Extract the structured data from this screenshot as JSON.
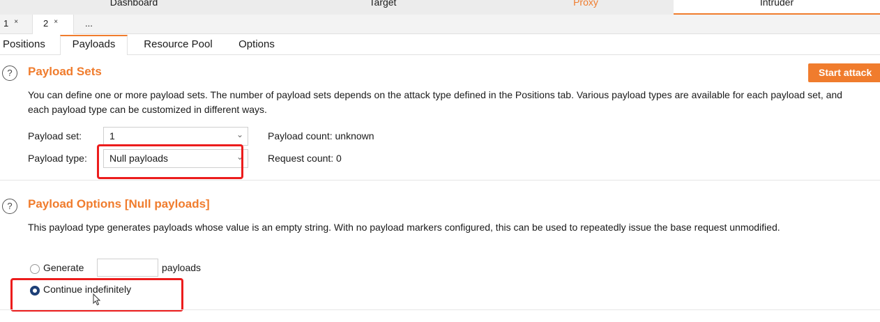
{
  "top_tabs": {
    "dashboard": "Dashboard",
    "target": "Target",
    "proxy": "Proxy",
    "intruder": "Intruder"
  },
  "attack_tabs": {
    "tab1": "1",
    "tab2": "2",
    "more": "...",
    "close_glyph": "×"
  },
  "sub_tabs": {
    "positions": "Positions",
    "payloads": "Payloads",
    "resource_pool": "Resource Pool",
    "options": "Options"
  },
  "help_glyph": "?",
  "payload_sets": {
    "title": "Payload Sets",
    "start_attack": "Start attack",
    "description": "You can define one or more payload sets. The number of payload sets depends on the attack type defined in the Positions tab. Various payload types are available for each payload set, and each payload type can be customized in different ways.",
    "payload_set_label": "Payload set:",
    "payload_set_value": "1",
    "payload_type_label": "Payload type:",
    "payload_type_value": "Null payloads",
    "payload_count": "Payload count: unknown",
    "request_count": "Request count: 0"
  },
  "payload_options": {
    "title": "Payload Options [Null payloads]",
    "description": "This payload type generates payloads whose value is an empty string. With no payload markers configured, this can be used to repeatedly issue the base request unmodified.",
    "generate_label": "Generate",
    "generate_value": "",
    "payloads_suffix": "payloads",
    "continue_label": "Continue indefinitely"
  },
  "colors": {
    "accent": "#f07c2d",
    "highlight": "#ec1c1c",
    "radio_selected": "#1d3f77"
  },
  "icons": [
    "help-icon",
    "chevron-down-icon",
    "close-icon",
    "mouse-cursor-icon"
  ]
}
